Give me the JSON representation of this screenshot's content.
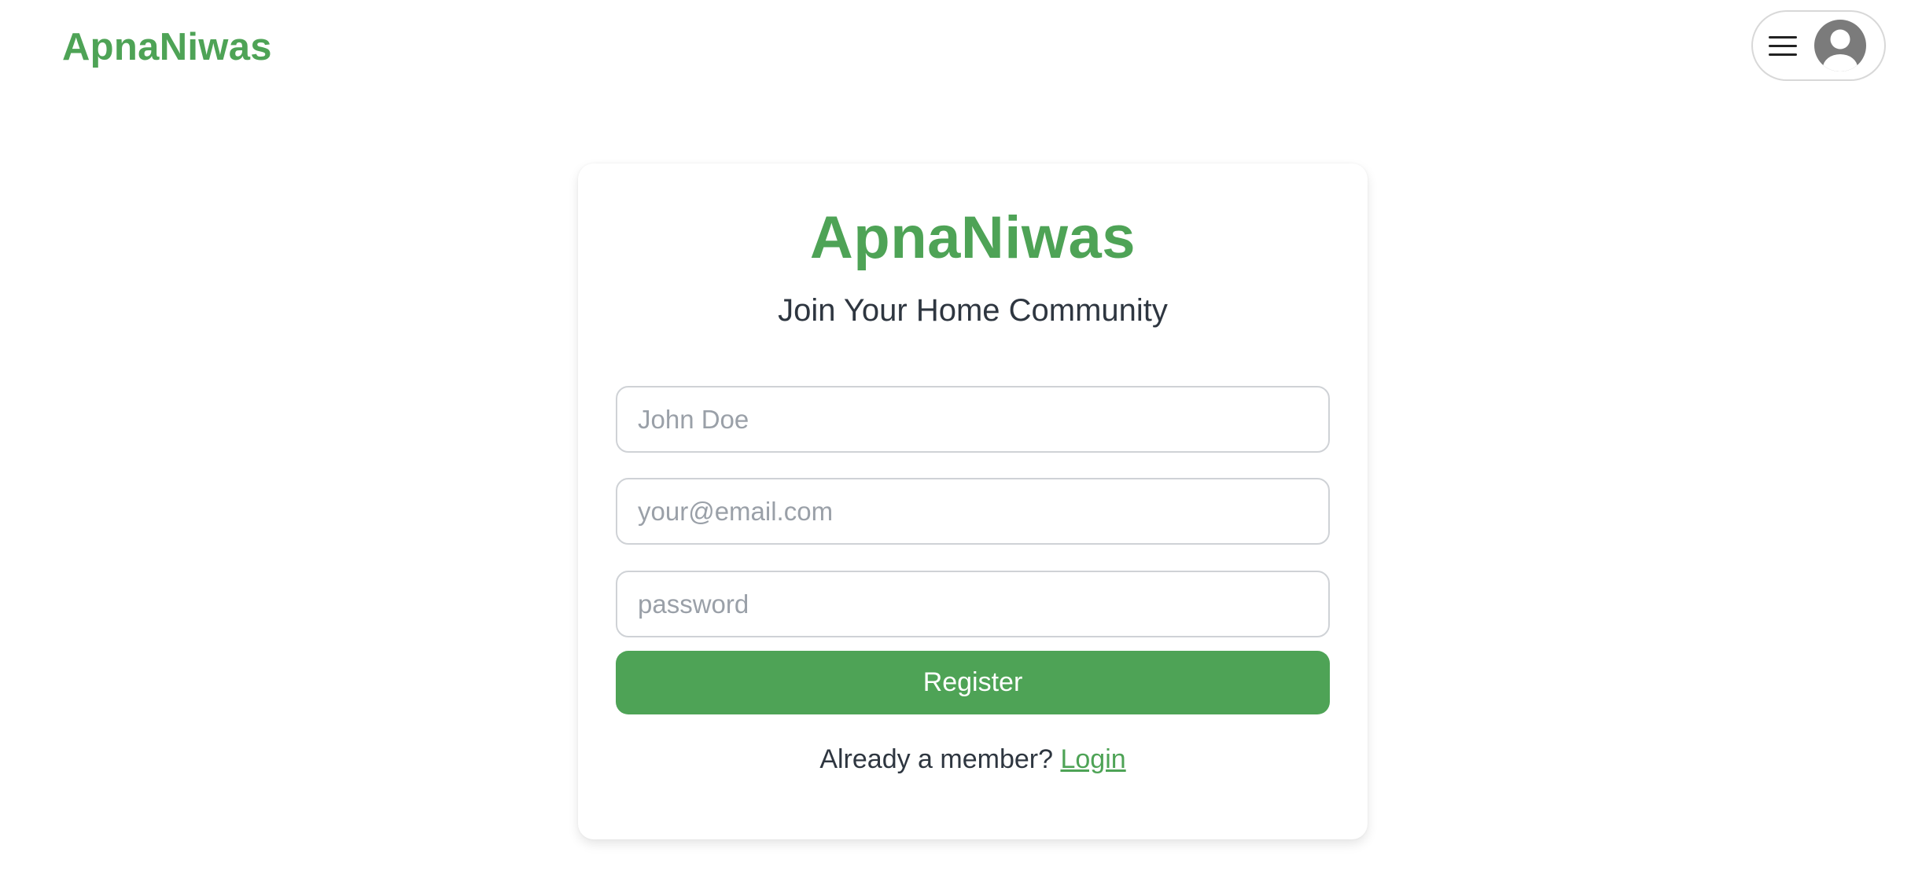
{
  "navbar": {
    "brand": "ApnaNiwas",
    "menu_icon": "hamburger-icon",
    "avatar_icon": "user-avatar-icon"
  },
  "card": {
    "title": "ApnaNiwas",
    "subtitle": "Join Your Home Community",
    "name_placeholder": "John Doe",
    "email_placeholder": "your@email.com",
    "password_placeholder": "password",
    "register_label": "Register",
    "login_prompt": "Already a member?",
    "login_link": "Login"
  },
  "colors": {
    "brand_green": "#4ea356",
    "text_dark": "#2e3640",
    "placeholder_gray": "#9aa0a8",
    "border_gray": "#cfd2d6"
  }
}
